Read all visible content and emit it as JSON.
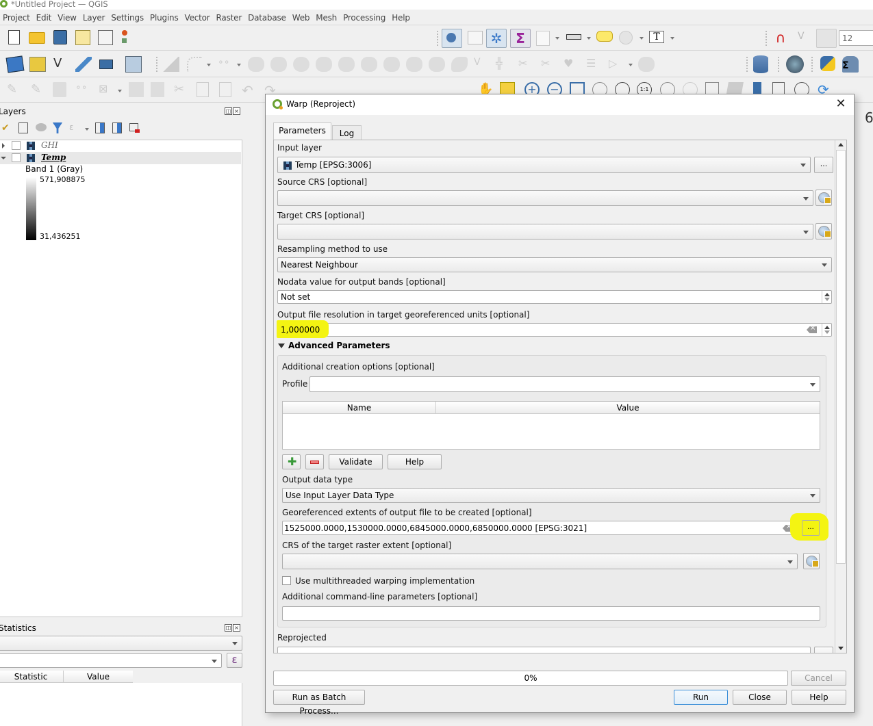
{
  "window": {
    "title": "*Untitled Project — QGIS"
  },
  "menubar": {
    "items": [
      "Project",
      "Edit",
      "View",
      "Layer",
      "Settings",
      "Plugins",
      "Vector",
      "Raster",
      "Database",
      "Web",
      "Mesh",
      "Processing",
      "Help"
    ]
  },
  "toolbar": {
    "font_size_value": "12",
    "partial_label": "6"
  },
  "layers_panel": {
    "title": "Layers",
    "layers": [
      {
        "name": "GHI",
        "expanded": false,
        "checked": false
      },
      {
        "name": "Temp",
        "expanded": true,
        "checked": false,
        "selected": true
      }
    ],
    "legend": {
      "band_label": "Band 1 (Gray)",
      "max_value": "571,908875",
      "min_value": "31,436251"
    }
  },
  "statistics_panel": {
    "title": "Statistics",
    "columns": [
      "Statistic",
      "Value"
    ],
    "expression_icon": "ε"
  },
  "dialog": {
    "title": "Warp (Reproject)",
    "tabs": [
      "Parameters",
      "Log"
    ],
    "active_tab": "Parameters",
    "params": {
      "input_layer": {
        "label": "Input layer",
        "value": "Temp [EPSG:3006]",
        "browse_label": "..."
      },
      "source_crs": {
        "label": "Source CRS [optional]",
        "value": ""
      },
      "target_crs": {
        "label": "Target CRS [optional]",
        "value": ""
      },
      "resampling": {
        "label": "Resampling method to use",
        "value": "Nearest Neighbour"
      },
      "nodata": {
        "label": "Nodata value for output bands [optional]",
        "value": "Not set"
      },
      "resolution": {
        "label": "Output file resolution in target georeferenced units [optional]",
        "value": "1,000000"
      }
    },
    "advanced": {
      "header": "Advanced Parameters",
      "creation_options_label": "Additional creation options [optional]",
      "profile_label": "Profile",
      "profile_value": "",
      "table_columns": [
        "Name",
        "Value"
      ],
      "validate_label": "Validate",
      "help_label": "Help",
      "output_data_type": {
        "label": "Output data type",
        "value": "Use Input Layer Data Type"
      },
      "extent": {
        "label": "Georeferenced extents of output file to be created [optional]",
        "value": "1525000.0000,1530000.0000,6845000.0000,6850000.0000 [EPSG:3021]",
        "browse_label": "..."
      },
      "extent_crs": {
        "label": "CRS of the target raster extent [optional]",
        "value": ""
      },
      "multithread": {
        "label": "Use multithreaded warping implementation",
        "checked": false
      },
      "extra_params": {
        "label": "Additional command-line parameters [optional]",
        "value": ""
      }
    },
    "reprojected_label": "Reprojected",
    "progress": {
      "percent": 0,
      "text": "0%"
    },
    "buttons": {
      "cancel": "Cancel",
      "batch": "Run as Batch Process...",
      "run": "Run",
      "close": "Close",
      "help": "Help"
    },
    "highlight_color": "#f4f412"
  }
}
